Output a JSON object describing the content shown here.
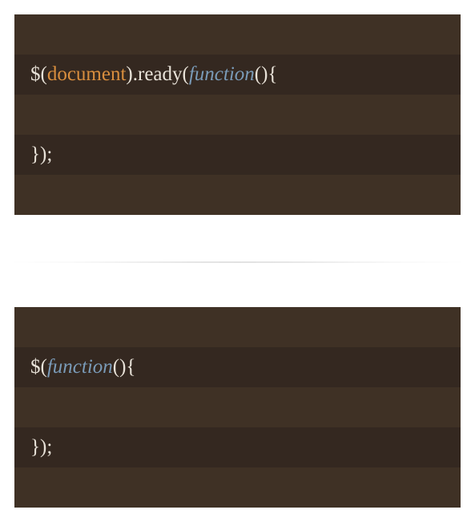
{
  "block1": {
    "line1": {
      "t0": "$(",
      "t1": "document",
      "t2": ").ready(",
      "t3": "function",
      "t4": "(){"
    },
    "line3": {
      "t0": "});"
    }
  },
  "block2": {
    "line1": {
      "t0": "$(",
      "t1": "function",
      "t2": "(){"
    },
    "line3": {
      "t0": "});"
    }
  }
}
